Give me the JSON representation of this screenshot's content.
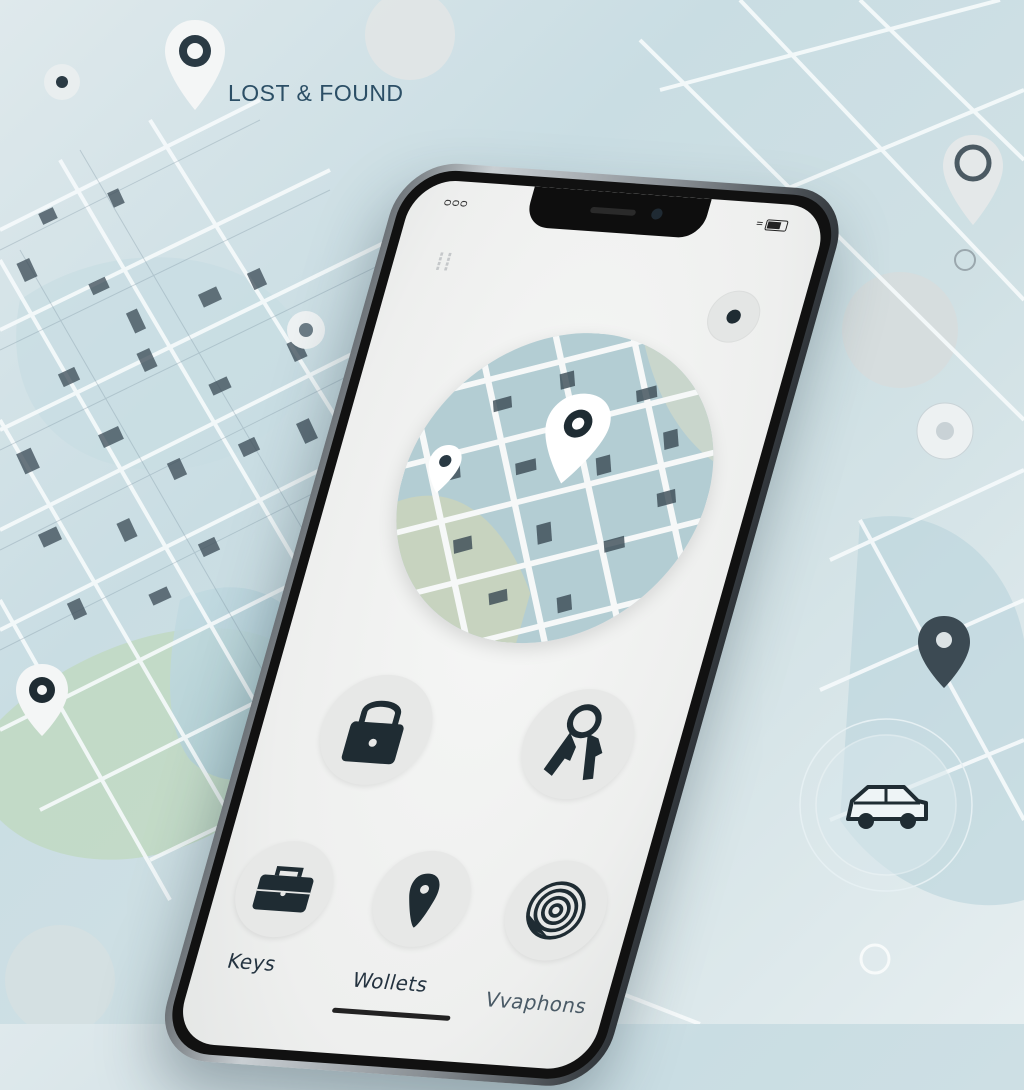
{
  "header": {
    "title": "LOST & FOUND"
  },
  "status_bar": {
    "left_text": "ᴑᴑᴑ",
    "right_text": "="
  },
  "categories": [
    {
      "label": "Keys",
      "icon": "keys-icon"
    },
    {
      "label": "Wollets",
      "icon": "wallet-icon"
    },
    {
      "label": "Vvaphons",
      "icon": "phone-icon"
    }
  ],
  "icon_buttons": [
    "padlock-icon",
    "keys-icon",
    "briefcase-icon",
    "tag-icon",
    "fingerprint-icon"
  ],
  "floating_icons": [
    "location-pin-icon",
    "car-icon"
  ],
  "colors": {
    "accent": "#1f2c33",
    "map_water": "#a9c9d4",
    "map_green": "#b9d49a",
    "screen_bg": "#f2f3f2"
  }
}
